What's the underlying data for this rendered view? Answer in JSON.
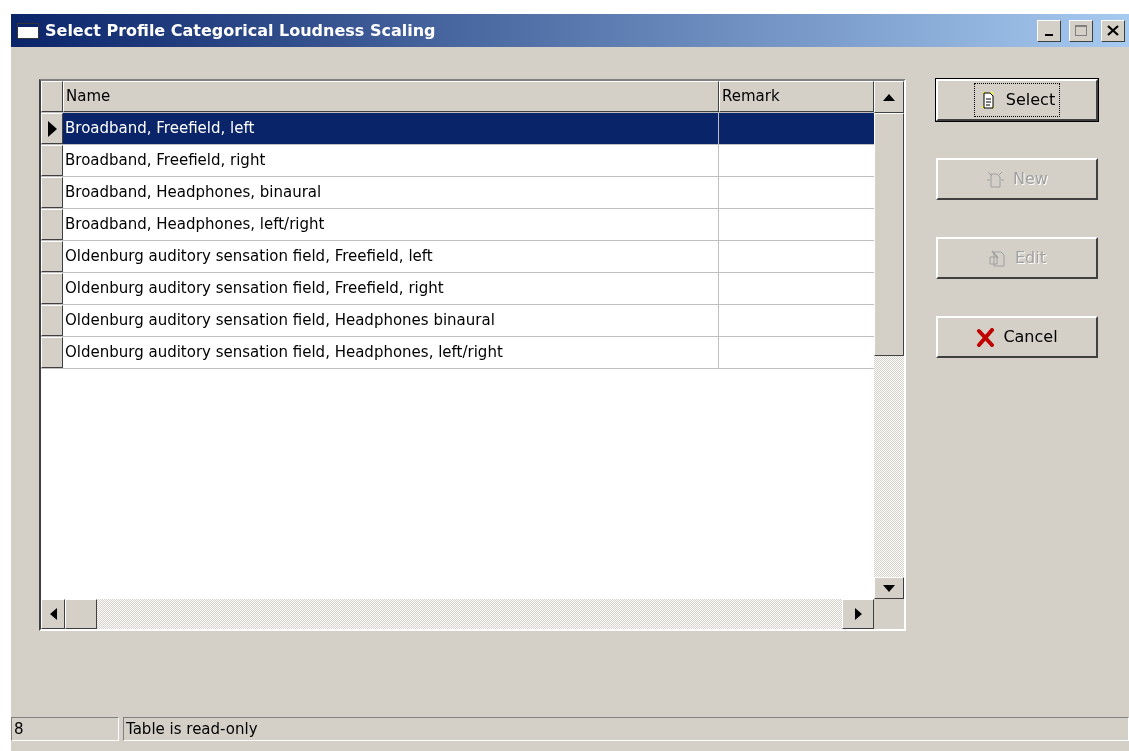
{
  "window": {
    "title": "Select Profile Categorical Loudness Scaling"
  },
  "table": {
    "columns": [
      "Name",
      "Remark"
    ],
    "rows": [
      {
        "name": "Broadband, Freefield, left",
        "selected": true
      },
      {
        "name": "Broadband, Freefield, right",
        "selected": false
      },
      {
        "name": "Broadband, Headphones, binaural",
        "selected": false
      },
      {
        "name": "Broadband, Headphones, left/right",
        "selected": false
      },
      {
        "name": "Oldenburg auditory sensation field, Freefield, left",
        "selected": false
      },
      {
        "name": "Oldenburg auditory sensation field, Freefield, right",
        "selected": false
      },
      {
        "name": "Oldenburg auditory sensation field, Headphones binaural",
        "selected": false
      },
      {
        "name": "Oldenburg auditory sensation field, Headphones, left/right",
        "selected": false
      }
    ]
  },
  "buttons": [
    {
      "kind": "select",
      "label": "Select",
      "disabled": false,
      "default": true
    },
    {
      "kind": "new",
      "label": "New",
      "disabled": true,
      "default": false
    },
    {
      "kind": "edit",
      "label": "Edit",
      "disabled": true,
      "default": false
    },
    {
      "kind": "cancel",
      "label": "Cancel",
      "disabled": false,
      "default": false
    }
  ],
  "status_bar": [
    "8",
    "Table is read-only"
  ]
}
